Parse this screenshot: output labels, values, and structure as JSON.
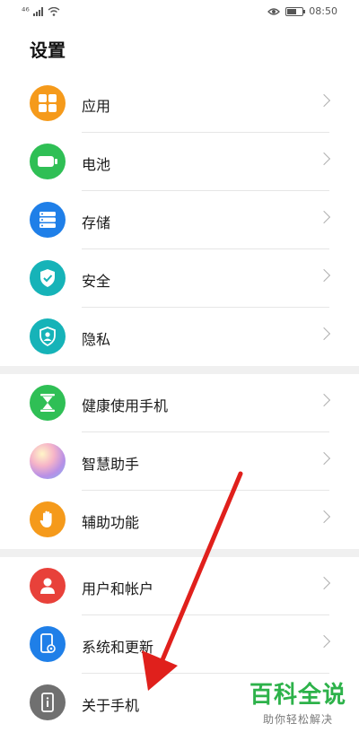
{
  "status_bar": {
    "signal_text": "⁴⁶",
    "time": "08:50",
    "battery_level": 0.6,
    "icons": [
      "signal-icon",
      "wifi-icon",
      "eye-icon",
      "battery-icon"
    ]
  },
  "page": {
    "title": "设置"
  },
  "groups": [
    {
      "items": [
        {
          "label": "应用",
          "icon": "apps-icon",
          "color": "#f59a1b"
        },
        {
          "label": "电池",
          "icon": "battery-icon",
          "color": "#2fbf55"
        },
        {
          "label": "存储",
          "icon": "storage-icon",
          "color": "#1f7fe8"
        },
        {
          "label": "安全",
          "icon": "shield-check-icon",
          "color": "#16b3b8"
        },
        {
          "label": "隐私",
          "icon": "privacy-icon",
          "color": "#16b3b8"
        }
      ]
    },
    {
      "items": [
        {
          "label": "健康使用手机",
          "icon": "hourglass-icon",
          "color": "#2fbf55"
        },
        {
          "label": "智慧助手",
          "icon": "assistant-icon",
          "color": "#c98fd8"
        },
        {
          "label": "辅助功能",
          "icon": "hand-icon",
          "color": "#f59a1b"
        }
      ]
    },
    {
      "items": [
        {
          "label": "用户和帐户",
          "icon": "user-icon",
          "color": "#e8413a"
        },
        {
          "label": "系统和更新",
          "icon": "system-update-icon",
          "color": "#1f7fe8"
        },
        {
          "label": "关于手机",
          "icon": "phone-info-icon",
          "color": "#707070"
        }
      ]
    }
  ],
  "watermark": {
    "main": "百科全说",
    "sub": "助你轻松解决"
  },
  "annotation": {
    "arrow_color": "#e0201c"
  }
}
